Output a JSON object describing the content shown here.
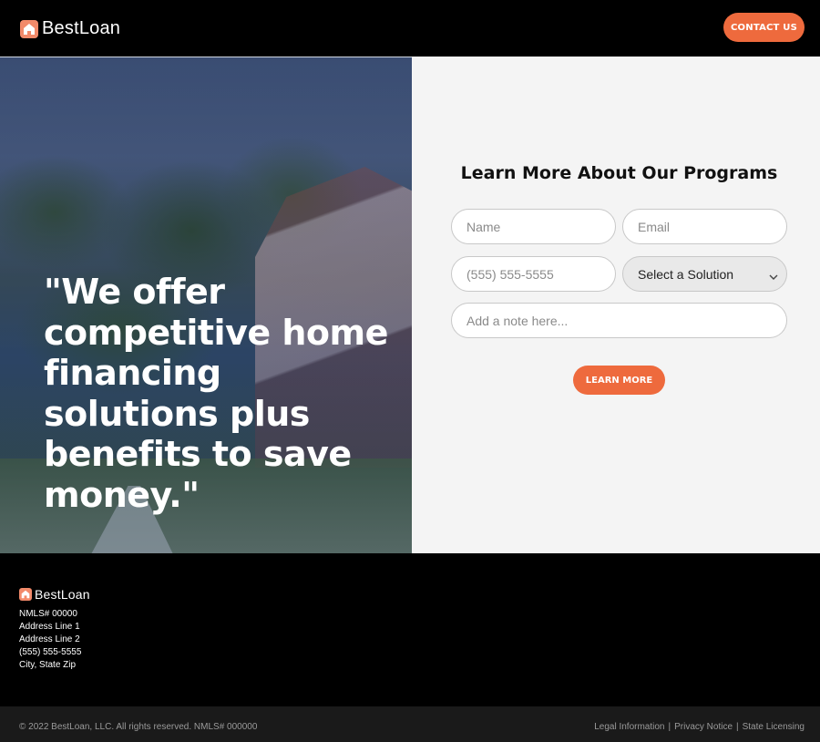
{
  "header": {
    "logo_text": "BestLoan",
    "logo_icon": "house-icon",
    "contact_label": "CONTACT US"
  },
  "hero": {
    "quote": "\"We offer competitive home financing solutions plus benefits to save money.\""
  },
  "form": {
    "title": "Learn More About Our Programs",
    "name_placeholder": "Name",
    "email_placeholder": "Email",
    "phone_placeholder": "(555) 555-5555",
    "solution_selected": "Select a Solution",
    "note_placeholder": "Add a note here...",
    "submit_label": "LEARN MORE"
  },
  "footer": {
    "logo_text": "BestLoan",
    "lines": [
      "NMLS# 00000",
      "Address Line 1",
      "Address Line 2",
      "(555) 555-5555",
      "City, State Zip"
    ],
    "copyright": "© 2022 BestLoan, LLC. All rights reserved. NMLS# 000000",
    "links": [
      "Legal Information",
      "Privacy Notice",
      "State Licensing"
    ],
    "separator": "|"
  },
  "colors": {
    "accent": "#ee6a3d",
    "logo_mark": "#f28a6a",
    "header_bg": "#000000",
    "form_bg": "#f4f4f4"
  }
}
